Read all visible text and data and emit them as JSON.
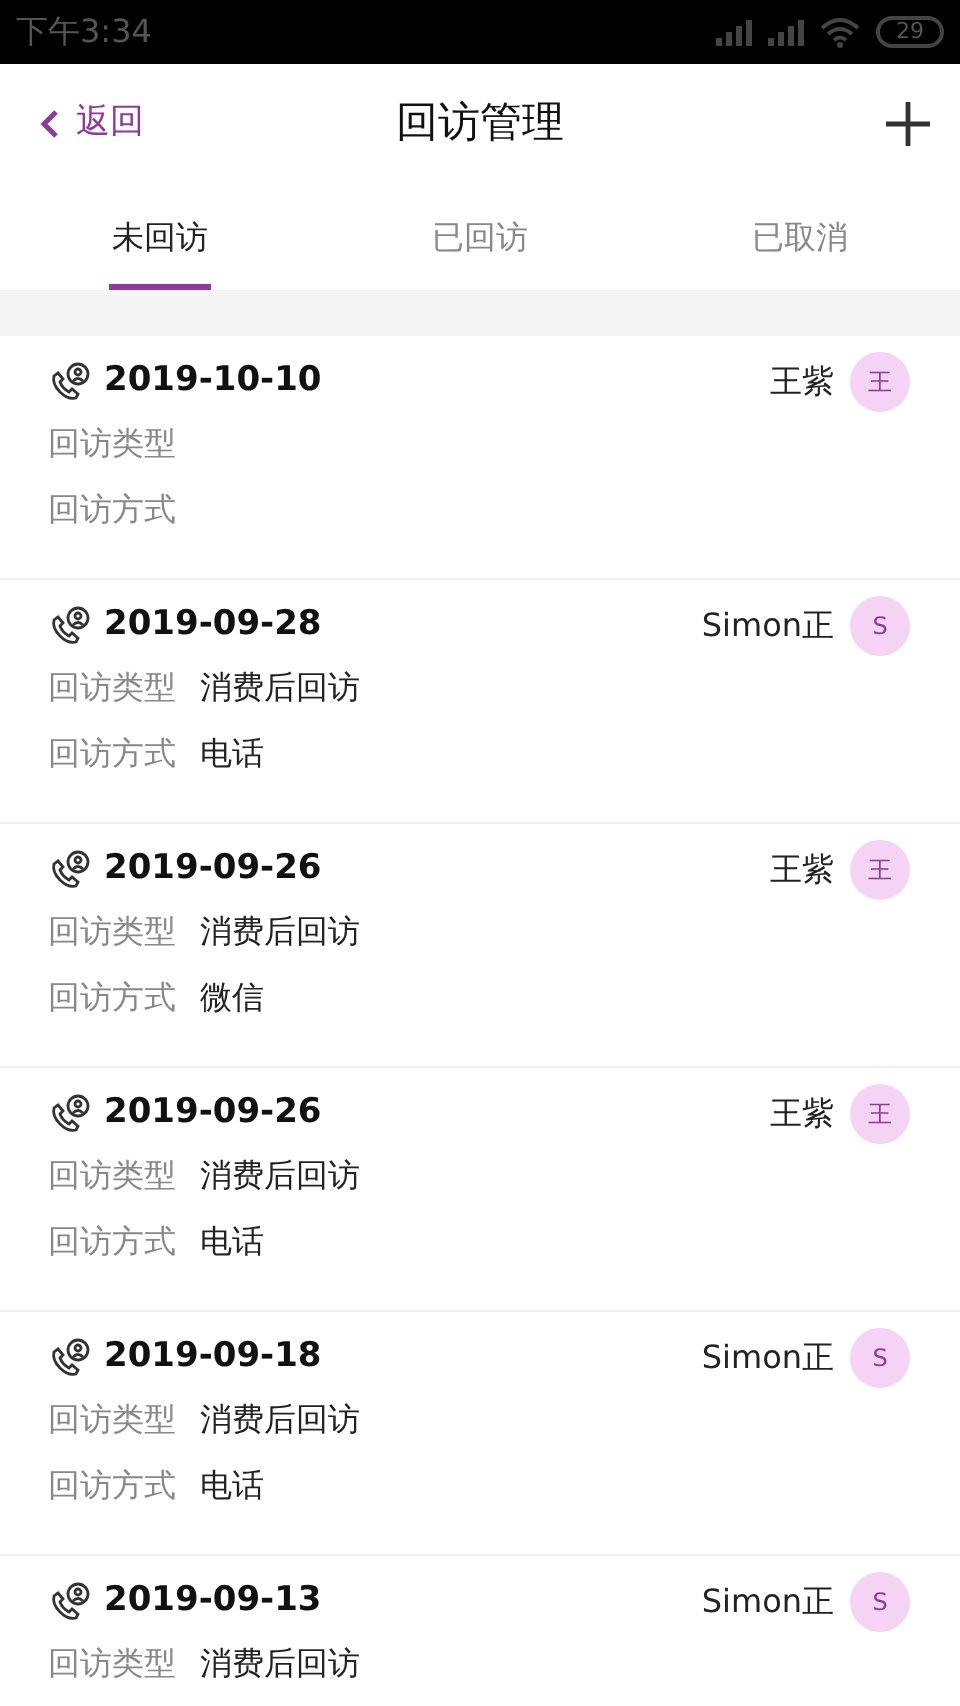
{
  "status_bar": {
    "time": "下午3:34",
    "battery": "29"
  },
  "header": {
    "back": "返回",
    "title": "回访管理"
  },
  "tabs": [
    {
      "label": "未回访",
      "selected": true
    },
    {
      "label": "已回访",
      "selected": false
    },
    {
      "label": "已取消",
      "selected": false
    }
  ],
  "visits": [
    {
      "date": "2019-10-10",
      "staff": "王紫",
      "avatar": "王",
      "type_label": "回访类型",
      "method_label": "回访方式"
    },
    {
      "date": "2019-09-28",
      "staff": "Simon正",
      "avatar": "S",
      "type_label": "回访类型",
      "type": "消费后回访",
      "method_label": "回访方式",
      "method": "电话"
    },
    {
      "date": "2019-09-26",
      "staff": "王紫",
      "avatar": "王",
      "type_label": "回访类型",
      "type": "消费后回访",
      "method_label": "回访方式",
      "method": "微信"
    },
    {
      "date": "2019-09-26",
      "staff": "王紫",
      "avatar": "王",
      "type_label": "回访类型",
      "type": "消费后回访",
      "method_label": "回访方式",
      "method": "电话"
    },
    {
      "date": "2019-09-18",
      "staff": "Simon正",
      "avatar": "S",
      "type_label": "回访类型",
      "type": "消费后回访",
      "method_label": "回访方式",
      "method": "电话"
    },
    {
      "date": "2019-09-13",
      "staff": "Simon正",
      "avatar": "S",
      "type_label": "回访类型",
      "type": "消费后回访"
    }
  ]
}
